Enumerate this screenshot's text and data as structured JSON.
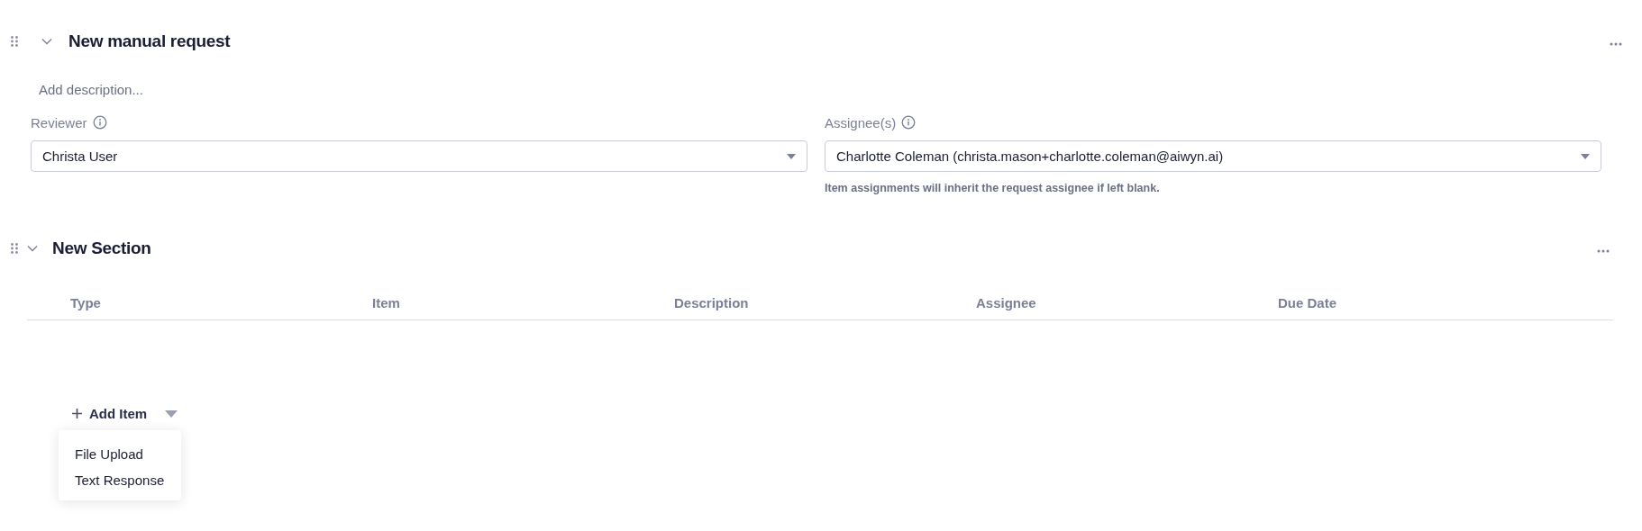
{
  "request": {
    "title": "New manual request",
    "expanded": true,
    "description_placeholder": "Add description...",
    "fields": [
      {
        "label": "Reviewer",
        "value": "Christa User"
      },
      {
        "label": "Assignee(s)",
        "value": "Charlotte Coleman (christa.mason+charlotte.coleman@aiwyn.ai)",
        "helper": "Item assignments will inherit the request assignee if left blank."
      }
    ]
  },
  "section": {
    "title": "New Section",
    "expanded": true,
    "columns": [
      "Type",
      "Item",
      "Description",
      "Assignee",
      "Due Date"
    ],
    "add_button": "Add Item",
    "menu": [
      "File Upload",
      "Text Response"
    ]
  }
}
